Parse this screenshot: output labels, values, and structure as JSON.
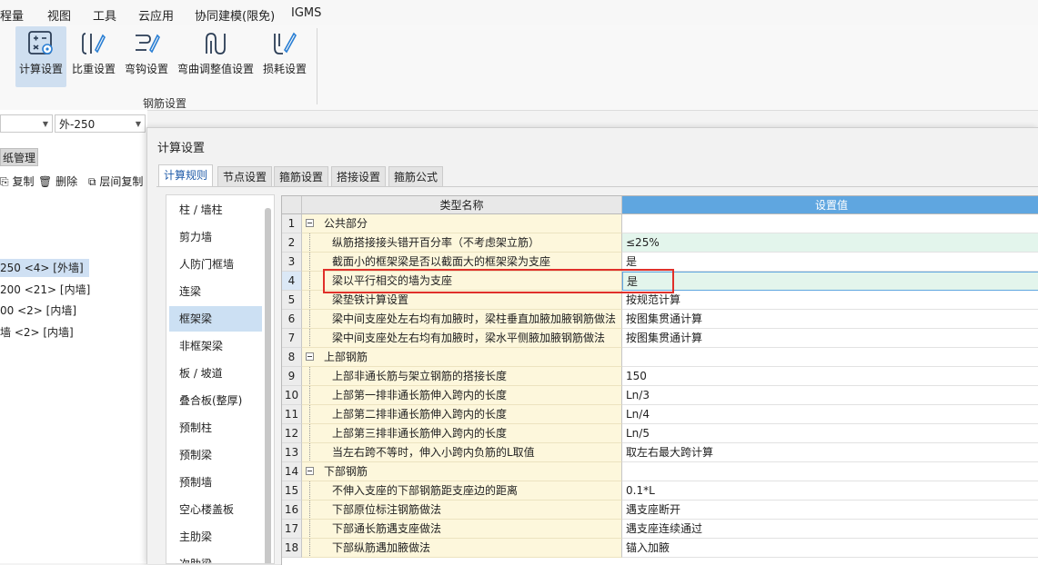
{
  "menubar": {
    "items": [
      "程量",
      "视图",
      "工具",
      "云应用",
      "协同建模(限免)",
      "IGMS"
    ]
  },
  "ribbon": {
    "buttons": [
      {
        "label": "计算设置",
        "icon": "calc-settings-icon"
      },
      {
        "label": "比重设置",
        "icon": "weight-settings-icon"
      },
      {
        "label": "弯钩设置",
        "icon": "hook-settings-icon"
      },
      {
        "label": "弯曲调整值设置",
        "icon": "bend-adjust-icon"
      },
      {
        "label": "损耗设置",
        "icon": "loss-settings-icon"
      }
    ],
    "group_label": "钢筋设置"
  },
  "background": {
    "combo1_value": "",
    "combo2_value": "外-250",
    "drawing_tab": "纸管理",
    "toolbar": {
      "copy": "复制",
      "delete": "删除",
      "floor_copy": "层间复制"
    },
    "walls": [
      "250 <4> [外墙]",
      "200 <21> [内墙]",
      "00 <2> [内墙]",
      "墙 <2> [内墙]"
    ]
  },
  "dialog": {
    "title": "计算设置",
    "tabs": [
      "计算规则",
      "节点设置",
      "箍筋设置",
      "搭接设置",
      "箍筋公式"
    ],
    "categories": [
      "柱 / 墙柱",
      "剪力墙",
      "人防门框墙",
      "连梁",
      "框架梁",
      "非框架梁",
      "板 / 坡道",
      "叠合板(整厚)",
      "预制柱",
      "预制梁",
      "预制墙",
      "空心楼盖板",
      "主肋梁",
      "次肋梁"
    ],
    "selected_category": "框架梁",
    "grid": {
      "headers": {
        "name": "类型名称",
        "value": "设置值"
      },
      "rows": [
        {
          "num": "1",
          "name": "公共部分",
          "value": ""
        },
        {
          "num": "2",
          "name": "纵筋搭接接头错开百分率（不考虑架立筋）",
          "value": "≤25%"
        },
        {
          "num": "3",
          "name": "截面小的框架梁是否以截面大的框架梁为支座",
          "value": "是"
        },
        {
          "num": "4",
          "name": "梁以平行相交的墙为支座",
          "value": "是"
        },
        {
          "num": "5",
          "name": "梁垫铁计算设置",
          "value": "按规范计算"
        },
        {
          "num": "6",
          "name": "梁中间支座处左右均有加腋时，梁柱垂直加腋加腋钢筋做法",
          "value": "按图集贯通计算"
        },
        {
          "num": "7",
          "name": "梁中间支座处左右均有加腋时，梁水平侧腋加腋钢筋做法",
          "value": "按图集贯通计算"
        },
        {
          "num": "8",
          "name": "上部钢筋",
          "value": ""
        },
        {
          "num": "9",
          "name": "上部非通长筋与架立钢筋的搭接长度",
          "value": "150"
        },
        {
          "num": "10",
          "name": "上部第一排非通长筋伸入跨内的长度",
          "value": "Ln/3"
        },
        {
          "num": "11",
          "name": "上部第二排非通长筋伸入跨内的长度",
          "value": "Ln/4"
        },
        {
          "num": "12",
          "name": "上部第三排非通长筋伸入跨内的长度",
          "value": "Ln/5"
        },
        {
          "num": "13",
          "name": "当左右跨不等时，伸入小跨内负筋的L取值",
          "value": "取左右最大跨计算"
        },
        {
          "num": "14",
          "name": "下部钢筋",
          "value": ""
        },
        {
          "num": "15",
          "name": "不伸入支座的下部钢筋距支座边的距离",
          "value": "0.1*L"
        },
        {
          "num": "16",
          "name": "下部原位标注钢筋做法",
          "value": "遇支座断开"
        },
        {
          "num": "17",
          "name": "下部通长筋遇支座做法",
          "value": "遇支座连续通过"
        },
        {
          "num": "18",
          "name": "下部纵筋遇加腋做法",
          "value": "锚入加腋"
        }
      ]
    }
  },
  "colors": {
    "accent": "#5fa6e0",
    "highlight_box": "#e0302a",
    "name_cell_bg": "#fdf7dc",
    "selected_bg": "#cfdff0"
  }
}
